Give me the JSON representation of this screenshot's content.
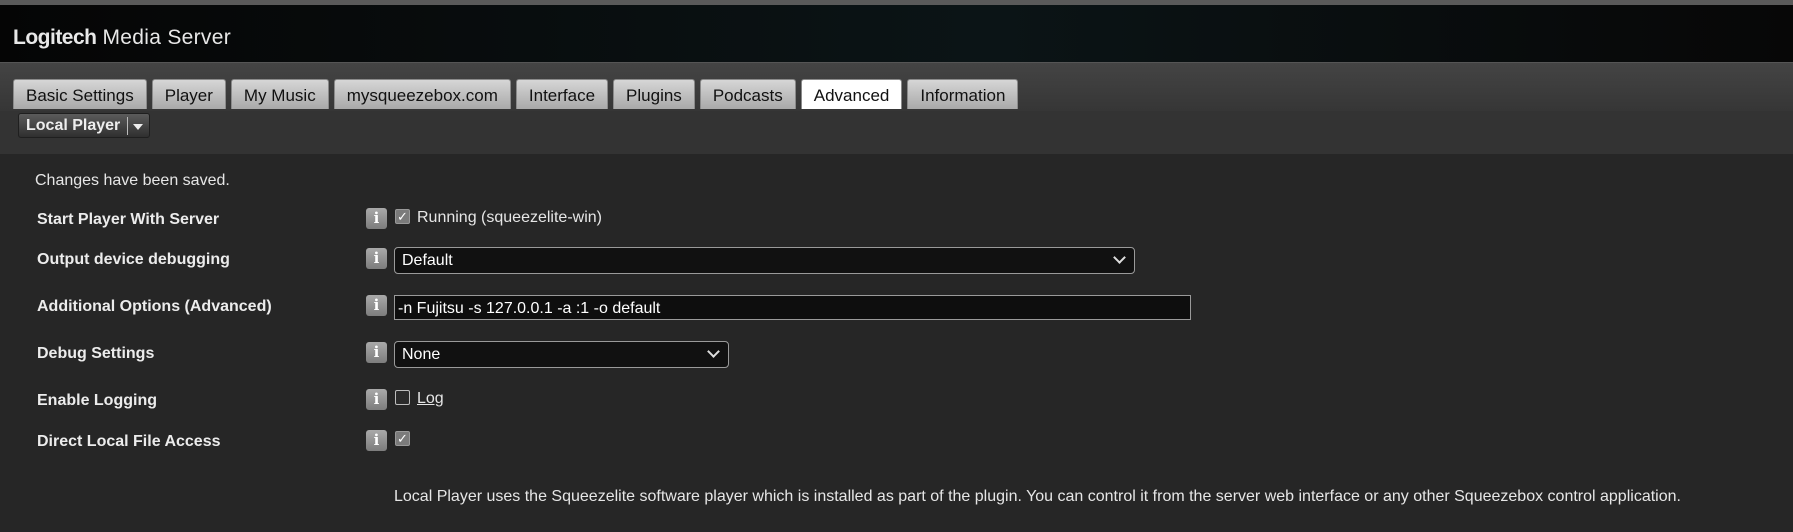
{
  "header": {
    "brand_logo": "Logitech",
    "brand_product": "Media Server"
  },
  "tabs": [
    {
      "label": "Basic Settings",
      "active": false
    },
    {
      "label": "Player",
      "active": false
    },
    {
      "label": "My Music",
      "active": false
    },
    {
      "label": "mysqueezebox.com",
      "active": false
    },
    {
      "label": "Interface",
      "active": false
    },
    {
      "label": "Plugins",
      "active": false
    },
    {
      "label": "Podcasts",
      "active": false
    },
    {
      "label": "Advanced",
      "active": true
    },
    {
      "label": "Information",
      "active": false
    }
  ],
  "subnav": {
    "dropdown_label": "Local Player"
  },
  "status": {
    "message": "Changes have been saved."
  },
  "settings": {
    "start_player": {
      "label": "Start Player With Server",
      "checked": true,
      "value_label": "Running (squeezelite-win)"
    },
    "output_debug": {
      "label": "Output device debugging",
      "selected": "Default"
    },
    "additional_options": {
      "label": "Additional Options (Advanced)",
      "value": "-n Fujitsu -s 127.0.0.1 -a :1 -o default"
    },
    "debug_settings": {
      "label": "Debug Settings",
      "selected": "None"
    },
    "enable_logging": {
      "label": "Enable Logging",
      "checked": false,
      "value_label": "Log"
    },
    "direct_file_access": {
      "label": "Direct Local File Access",
      "checked": true
    }
  },
  "description": "Local Player uses the Squeezelite software player which is installed as part of the plugin. You can control it from the server web interface or any other Squeezebox control application.",
  "icons": {
    "info": "i",
    "check": "✓"
  },
  "colors": {
    "background": "#262626",
    "header": "#050505",
    "tab_active": "#ffffff",
    "tab_inactive": "#c4c4c4"
  }
}
